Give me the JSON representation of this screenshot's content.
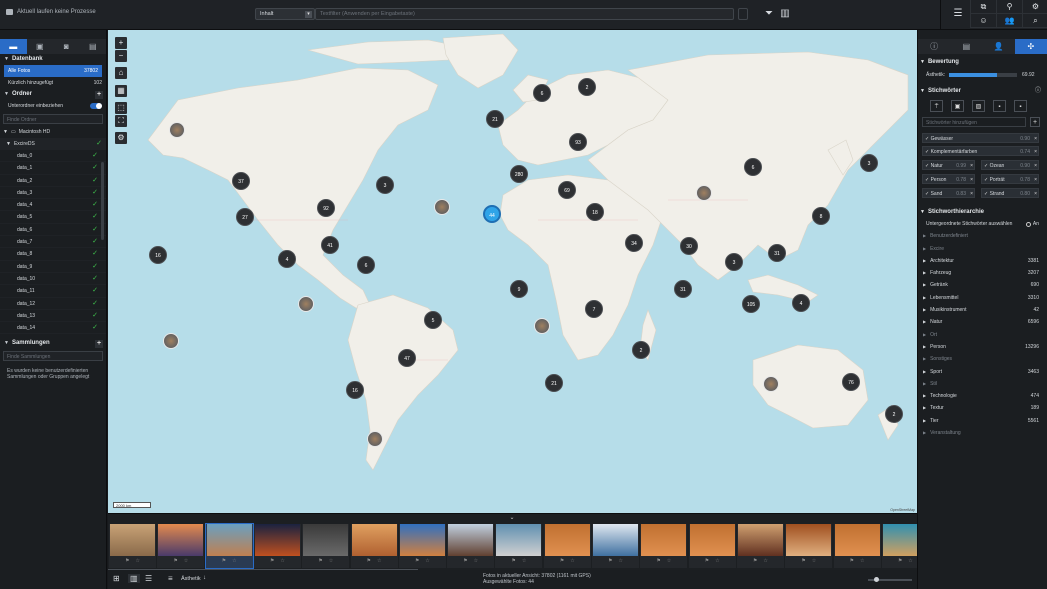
{
  "topbar": {
    "process_status": "Aktuell laufen keine Prozesse",
    "scope_value": "Inhalt",
    "search_placeholder": "Textfilter (Anwenden per Eingabetaste)"
  },
  "left": {
    "db_title": "Datenbank",
    "db_rows": [
      {
        "label": "Alle Fotos",
        "count": "37802"
      },
      {
        "label": "Kürzlich hinzugefügt",
        "count": "102"
      }
    ],
    "folders_title": "Ordner",
    "subfolders_label": "Unterordner einbeziehen",
    "folder_search_placeholder": "Finde Ordner",
    "drive": "Macintosh HD",
    "root": "ExcireDS",
    "folders": [
      "data_0",
      "data_1",
      "data_2",
      "data_3",
      "data_4",
      "data_5",
      "data_6",
      "data_7",
      "data_8",
      "data_9",
      "data_10",
      "data_11",
      "data_12",
      "data_13",
      "data_14"
    ],
    "collections_title": "Sammlungen",
    "collection_search_placeholder": "Finde Sammlungen",
    "collections_empty": "Es wurden keine benutzerdefinierten Sammlungen oder Gruppen angelegt"
  },
  "map": {
    "scale_label": "2000 km",
    "attribution": "OpenStreetMap",
    "clusters": [
      {
        "n": "37"
      },
      {
        "n": "27"
      },
      {
        "n": "92"
      },
      {
        "n": "3"
      },
      {
        "n": "41"
      },
      {
        "n": "4"
      },
      {
        "n": "16"
      },
      {
        "n": "6"
      },
      {
        "n": "21"
      },
      {
        "n": "6"
      },
      {
        "n": "2"
      },
      {
        "n": "93"
      },
      {
        "n": "280"
      },
      {
        "n": "69"
      },
      {
        "n": "18"
      },
      {
        "n": "44"
      },
      {
        "n": "6"
      },
      {
        "n": "3"
      },
      {
        "n": "8"
      },
      {
        "n": "34"
      },
      {
        "n": "30"
      },
      {
        "n": "31"
      },
      {
        "n": "3"
      },
      {
        "n": "31"
      },
      {
        "n": "4"
      },
      {
        "n": "105"
      },
      {
        "n": "7"
      },
      {
        "n": "9"
      },
      {
        "n": "5"
      },
      {
        "n": "47"
      },
      {
        "n": "2"
      },
      {
        "n": "16"
      },
      {
        "n": "21"
      },
      {
        "n": "76"
      },
      {
        "n": "2"
      }
    ]
  },
  "status": {
    "line1": "Fotos in aktueller Ansicht:  37802  (1161 mit GPS)",
    "line2": "Ausgewählte Fotos:  44",
    "sort_label": "Ästhetik"
  },
  "right": {
    "rating_title": "Bewertung",
    "aesthetic_label": "Ästhetik:",
    "aesthetic_value": "69.92",
    "aesthetic_fill": 0.7,
    "keywords_title": "Stichwörter",
    "keyword_placeholder": "Stichwörter hinzufügen",
    "keywords": [
      {
        "label": "Gewässer",
        "score": "0.90"
      },
      {
        "label": "Komplementärfarben",
        "score": "0.74"
      },
      {
        "label": "Natur",
        "score": "0.99"
      },
      {
        "label": "Ozean",
        "score": "0.90"
      },
      {
        "label": "Person",
        "score": "0.78"
      },
      {
        "label": "Porträt",
        "score": "0.78"
      },
      {
        "label": "Sand",
        "score": "0.83"
      },
      {
        "label": "Strand",
        "score": "0.80"
      }
    ],
    "hierarchy_title": "Stichworthierarchie",
    "hierarchy_sub_label": "Untergeordnete Stichwörter auswählen",
    "hierarchy_sub_state": "An",
    "hierarchy": [
      {
        "label": "Benutzerdefiniert",
        "count": "",
        "dim": true
      },
      {
        "label": "Excire",
        "count": "",
        "dim": true
      },
      {
        "label": "Architektur",
        "count": "3381",
        "dim": false
      },
      {
        "label": "Fahrzeug",
        "count": "3207",
        "dim": false
      },
      {
        "label": "Getränk",
        "count": "690",
        "dim": false
      },
      {
        "label": "Lebensmittel",
        "count": "3310",
        "dim": false
      },
      {
        "label": "Musikinstrument",
        "count": "42",
        "dim": false
      },
      {
        "label": "Natur",
        "count": "6596",
        "dim": false
      },
      {
        "label": "Ort",
        "count": "",
        "dim": true
      },
      {
        "label": "Person",
        "count": "13296",
        "dim": false
      },
      {
        "label": "Sonstiges",
        "count": "",
        "dim": true
      },
      {
        "label": "Sport",
        "count": "3463",
        "dim": false
      },
      {
        "label": "Stil",
        "count": "",
        "dim": true
      },
      {
        "label": "Technologie",
        "count": "474",
        "dim": false
      },
      {
        "label": "Textur",
        "count": "189",
        "dim": false
      },
      {
        "label": "Tier",
        "count": "5561",
        "dim": false
      },
      {
        "label": "Veranstaltung",
        "count": "",
        "dim": true
      }
    ]
  },
  "colors": {
    "accent": "#2a6cc7",
    "check": "#3fc04c",
    "water": "#b6dde9",
    "land": "#f1efe9"
  }
}
